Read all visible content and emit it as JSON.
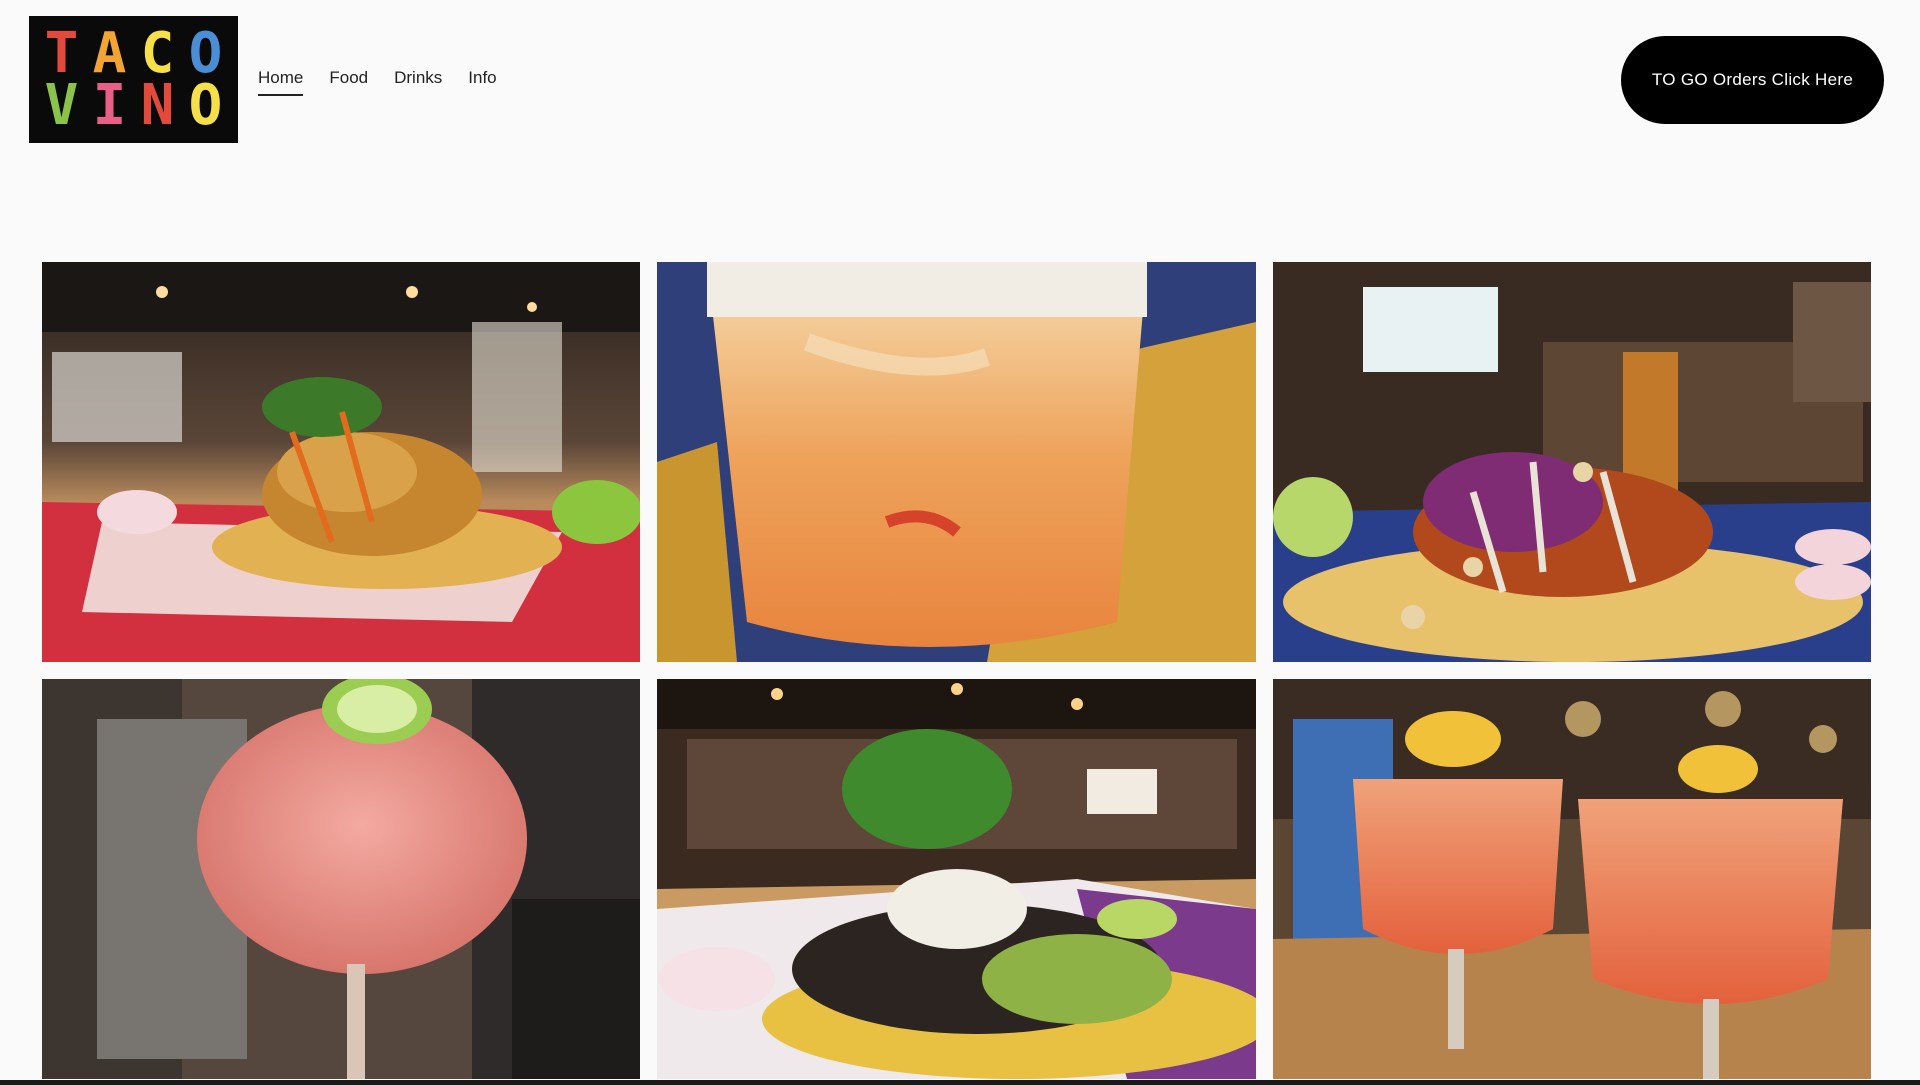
{
  "site": {
    "logo_letters": [
      {
        "char": "T",
        "color": "#e24a3b"
      },
      {
        "char": "A",
        "color": "#f2a533"
      },
      {
        "char": "C",
        "color": "#f5e04a"
      },
      {
        "char": "O",
        "color": "#4a8fd6"
      },
      {
        "char": "V",
        "color": "#8bc34a"
      },
      {
        "char": "I",
        "color": "#e8608a"
      },
      {
        "char": "N",
        "color": "#e24a3b"
      },
      {
        "char": "O",
        "color": "#f5e04a"
      }
    ]
  },
  "nav": {
    "items": [
      {
        "label": "Home",
        "active": true
      },
      {
        "label": "Food",
        "active": false
      },
      {
        "label": "Drinks",
        "active": false
      },
      {
        "label": "Info",
        "active": false
      }
    ]
  },
  "cta": {
    "label": "TO GO Orders Click Here",
    "background": "#000000",
    "color": "#ffffff"
  },
  "gallery": {
    "tiles": [
      {
        "name": "gallery-photo-fried-taco"
      },
      {
        "name": "gallery-photo-margarita"
      },
      {
        "name": "gallery-photo-korean-taco"
      },
      {
        "name": "gallery-photo-pink-cocktail"
      },
      {
        "name": "gallery-photo-carne-taco"
      },
      {
        "name": "gallery-photo-orange-cocktails"
      }
    ]
  }
}
